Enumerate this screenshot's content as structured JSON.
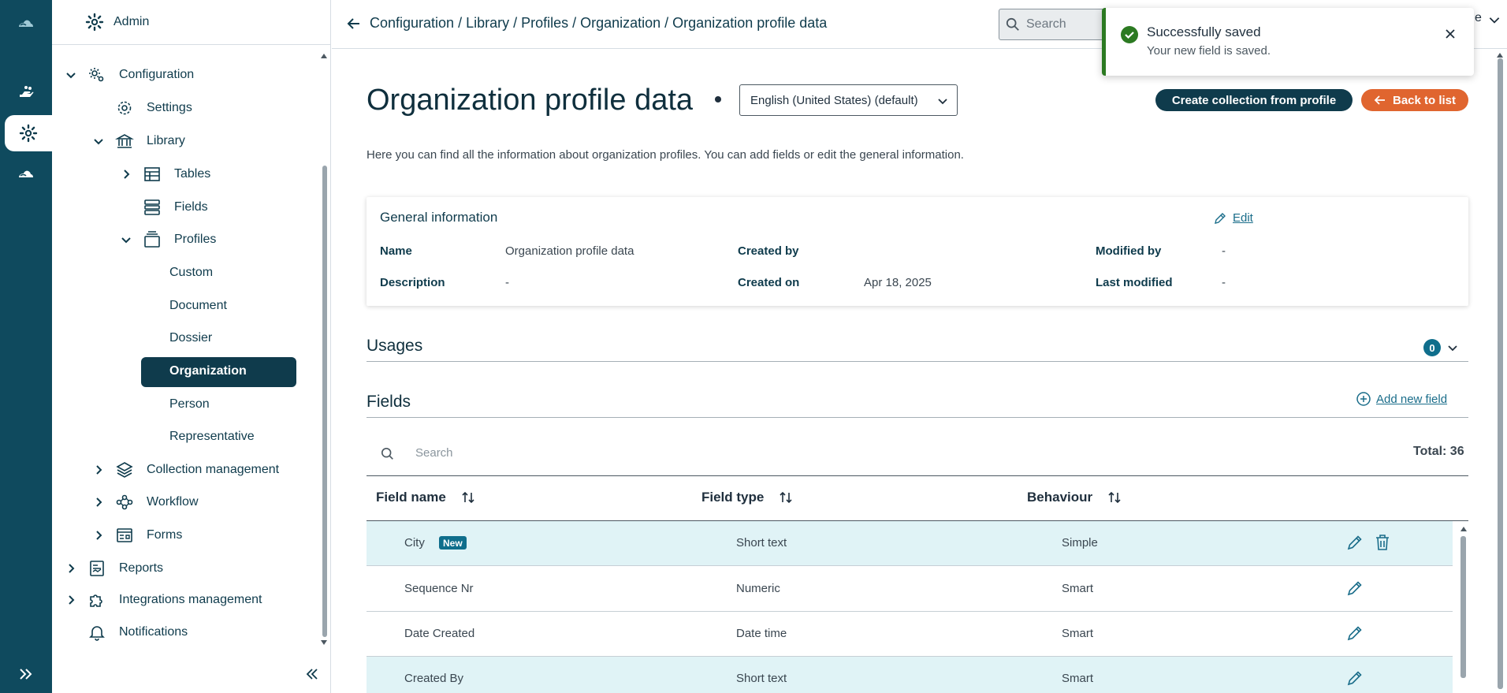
{
  "sidebar": {
    "header": "Admin",
    "items": [
      {
        "label": "Configuration"
      },
      {
        "label": "Settings"
      },
      {
        "label": "Library"
      },
      {
        "label": "Tables"
      },
      {
        "label": "Fields"
      },
      {
        "label": "Profiles"
      },
      {
        "label": "Custom"
      },
      {
        "label": "Document"
      },
      {
        "label": "Dossier"
      },
      {
        "label": "Organization"
      },
      {
        "label": "Person"
      },
      {
        "label": "Representative"
      },
      {
        "label": "Collection management"
      },
      {
        "label": "Workflow"
      },
      {
        "label": "Forms"
      },
      {
        "label": "Reports"
      },
      {
        "label": "Integrations management"
      },
      {
        "label": "Notifications"
      }
    ]
  },
  "topbar": {
    "breadcrumb": "Configuration / Library / Profiles / Organization / Organization profile data",
    "search_placeholder": "Search",
    "user_fragment": "e"
  },
  "toast": {
    "title": "Successfully saved",
    "message": "Your new field is saved."
  },
  "page": {
    "title": "Organization profile data",
    "language": "English (United States) (default)",
    "create_btn": "Create collection from profile",
    "back_btn": "Back to list",
    "intro": "Here you can find all the information about organization profiles. You can add fields or edit the general information."
  },
  "general": {
    "title": "General information",
    "edit": "Edit",
    "name_label": "Name",
    "name_value": "Organization profile data",
    "description_label": "Description",
    "description_value": "-",
    "created_by_label": "Created by",
    "created_by_value": "",
    "created_on_label": "Created on",
    "created_on_value": "Apr 18, 2025",
    "modified_by_label": "Modified by",
    "modified_by_value": "-",
    "last_modified_label": "Last modified",
    "last_modified_value": "-"
  },
  "usages": {
    "title": "Usages",
    "count": "0"
  },
  "fields": {
    "title": "Fields",
    "add": "Add new field",
    "search_placeholder": "Search",
    "total": "Total: 36",
    "columns": [
      "Field name",
      "Field type",
      "Behaviour"
    ],
    "rows": [
      {
        "name": "City",
        "badge": "New",
        "type": "Short text",
        "behaviour": "Simple"
      },
      {
        "name": "Sequence Nr",
        "type": "Numeric",
        "behaviour": "Smart"
      },
      {
        "name": "Date Created",
        "type": "Date time",
        "behaviour": "Smart"
      },
      {
        "name": "Created By",
        "type": "Short text",
        "behaviour": "Smart"
      }
    ]
  },
  "colors": {
    "primary": "#0f3b4c",
    "accent": "#e0652f",
    "success": "#2c7a22",
    "highlight": "#e0f3f6"
  }
}
